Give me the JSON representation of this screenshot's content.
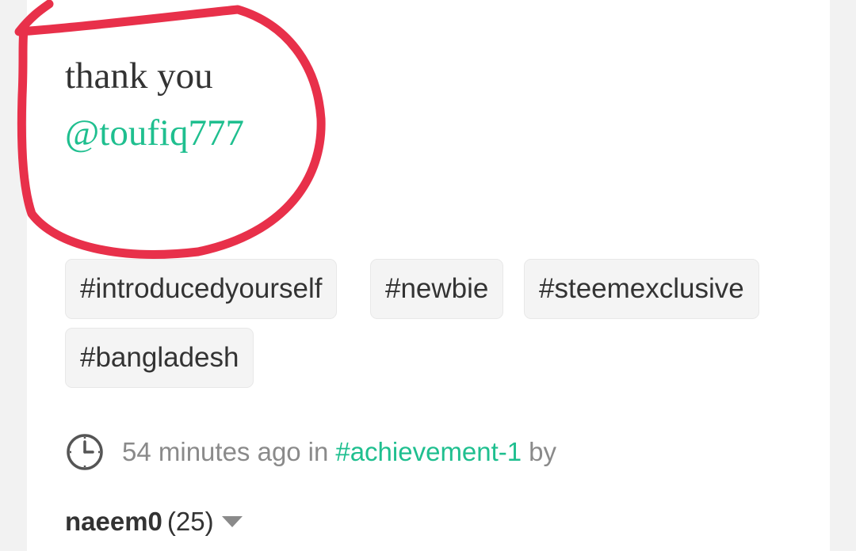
{
  "post": {
    "body_line1": "thank you",
    "mention": "@toufiq777"
  },
  "tags": [
    "#introducedyourself",
    "#newbie",
    "#steemexclusive",
    "#bangladesh"
  ],
  "meta": {
    "time": "54 minutes ago",
    "in_word": "in",
    "category": "#achievement-1",
    "by_word": "by",
    "icon": "clock-icon"
  },
  "author": {
    "name": "naeem0",
    "reputation": "(25)",
    "icon": "caret-down-icon"
  },
  "colors": {
    "accent": "#1fbf8f",
    "annotation": "#e8304a",
    "tag_bg": "#f4f4f4",
    "text": "#333333",
    "muted": "#8a8a8a"
  }
}
